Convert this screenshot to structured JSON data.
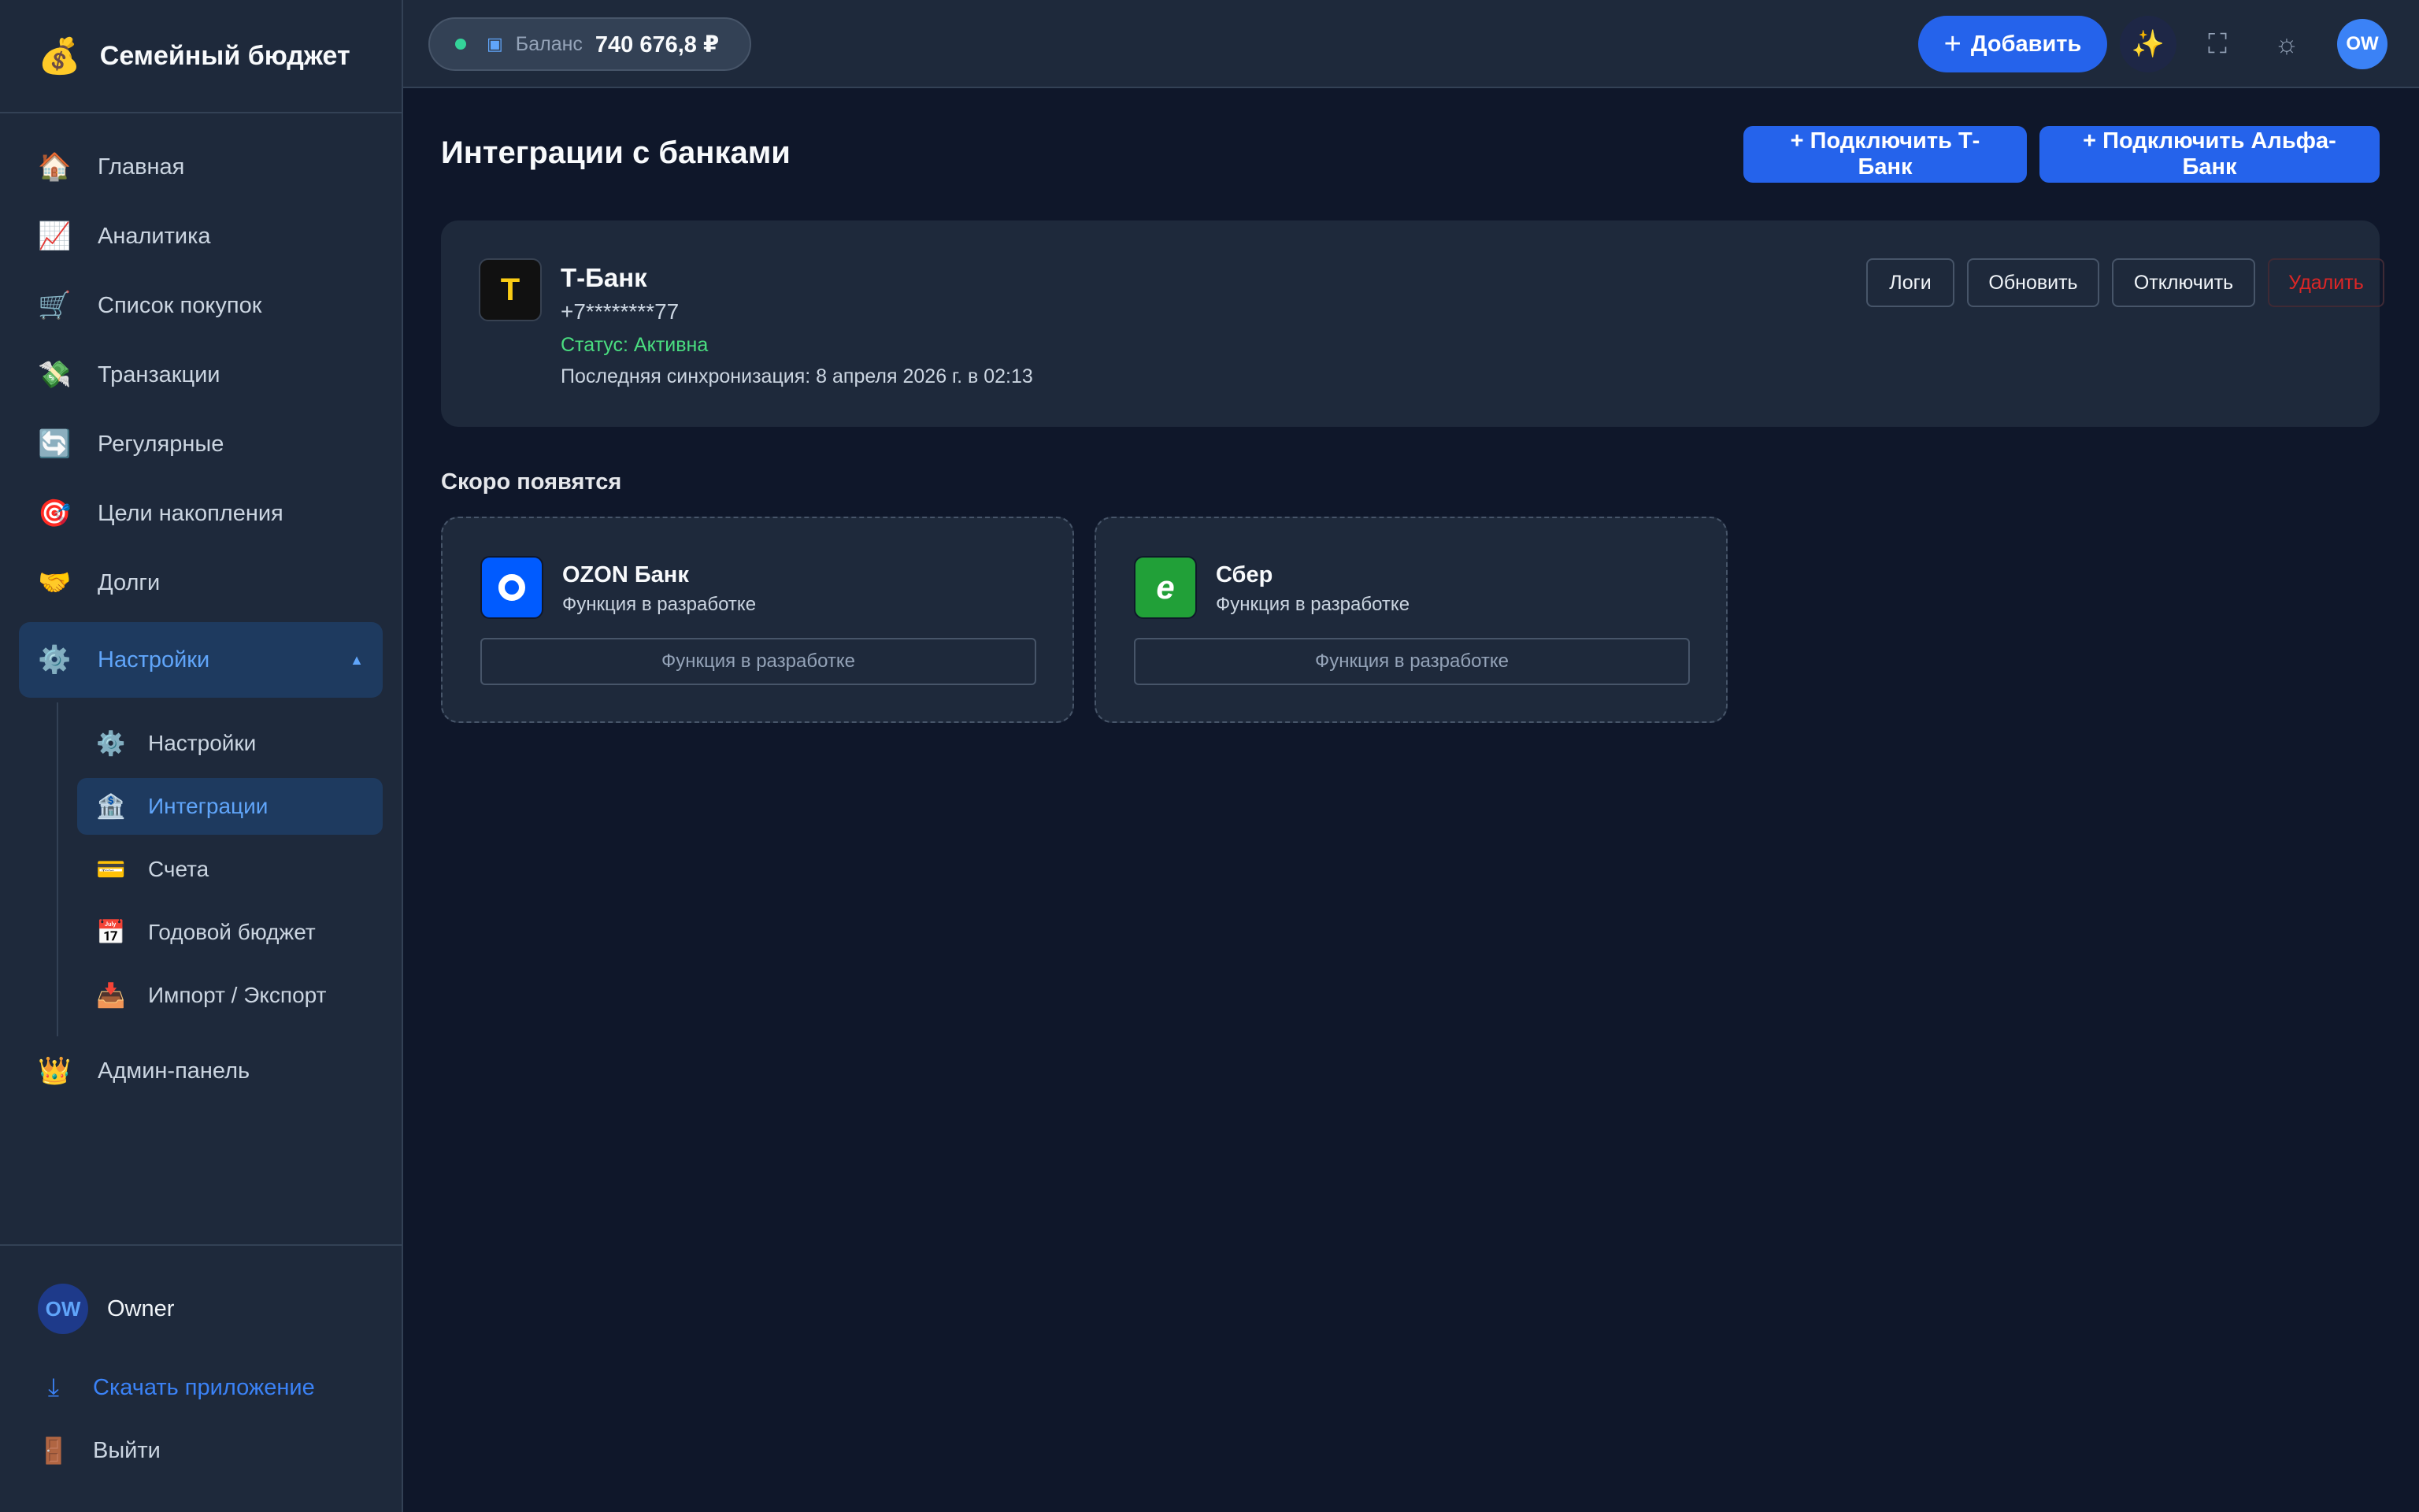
{
  "sidebar": {
    "brand": {
      "emoji": "💰",
      "title": "Семейный бюджет"
    },
    "items": [
      {
        "icon": "🏠",
        "label": "Главная"
      },
      {
        "icon": "📈",
        "label": "Аналитика"
      },
      {
        "icon": "🛒",
        "label": "Список покупок"
      },
      {
        "icon": "💸",
        "label": "Транзакции"
      },
      {
        "icon": "🔄",
        "label": "Регулярные"
      },
      {
        "icon": "🎯",
        "label": "Цели накопления"
      },
      {
        "icon": "🤝",
        "label": "Долги"
      }
    ],
    "group": {
      "icon": "⚙️",
      "label": "Настройки",
      "caret": "▲"
    },
    "subitems": [
      {
        "icon": "⚙️",
        "label": "Настройки"
      },
      {
        "icon": "🏦",
        "label": "Интеграции"
      },
      {
        "icon": "💳",
        "label": "Счета"
      },
      {
        "icon": "📅",
        "label": "Годовой бюджет"
      },
      {
        "icon": "📥",
        "label": "Импорт / Экспорт"
      }
    ],
    "admin": {
      "icon": "👑",
      "label": "Админ-панель"
    },
    "user": {
      "initials": "OW",
      "name": "Owner"
    },
    "download": {
      "icon": "⤓",
      "label": "Скачать приложение"
    },
    "logout": {
      "icon": "🚪",
      "label": "Выйти"
    }
  },
  "topbar": {
    "balance_icon": "▣",
    "balance_label": "Баланс",
    "balance_value": "740 676,8 ₽",
    "add_plus": "+",
    "add_label": "Добавить",
    "sparkle": "✨",
    "screenshot": "⛶",
    "theme": "☼",
    "avatar": "OW"
  },
  "main": {
    "title": "Интеграции с банками",
    "connect_tbank": "+ Подключить Т-Банк",
    "connect_alfa": "+ Подключить Альфа-Банк",
    "connected": {
      "logo": "T",
      "name": "Т-Банк",
      "phone": "+7********77",
      "status": "Статус: Активна",
      "sync": "Последняя синхронизация: 8 апреля 2026 г. в 02:13",
      "actions": {
        "logs": "Логи",
        "refresh": "Обновить",
        "disconnect": "Отключить",
        "delete": "Удалить"
      }
    },
    "soon_title": "Скоро появятся",
    "soon": [
      {
        "name": "OZON Банк",
        "sub": "Функция в разработке",
        "button": "Функция в разработке"
      },
      {
        "name": "Сбер",
        "logo": "e",
        "sub": "Функция в разработке",
        "button": "Функция в разработке"
      }
    ]
  },
  "colors": {
    "accent": "#2563eb",
    "status_active": "#4ade80",
    "danger": "#dc2626"
  }
}
